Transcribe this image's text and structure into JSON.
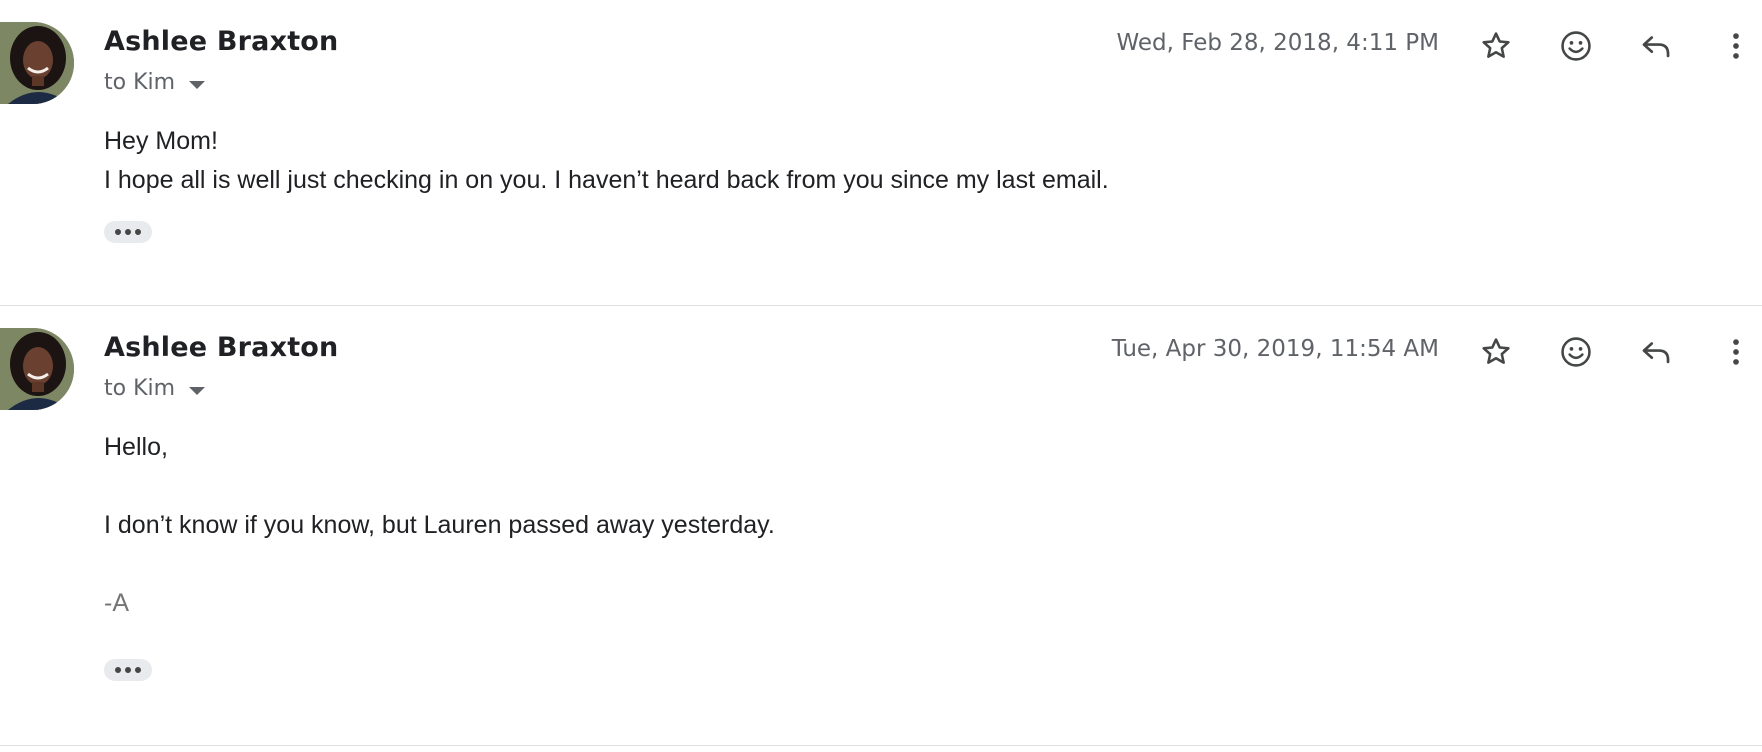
{
  "messages": [
    {
      "sender": "Ashlee Braxton",
      "recipient": "to Kim",
      "date": "Wed, Feb 28, 2018, 4:11 PM",
      "body": [
        "Hey Mom!",
        "I hope all is well just checking in on you. I haven’t heard back from you since my last email."
      ]
    },
    {
      "sender": "Ashlee Braxton",
      "recipient": "to Kim",
      "date": "Tue, Apr 30, 2019, 11:54 AM",
      "body": [
        "Hello,",
        "",
        "I don’t know if you know, but Lauren passed away yesterday.",
        "",
        "-A"
      ]
    }
  ],
  "icons": {
    "star": "star-outline-icon",
    "emoji": "add-reaction-icon",
    "reply": "reply-icon",
    "more": "more-vert-icon"
  }
}
